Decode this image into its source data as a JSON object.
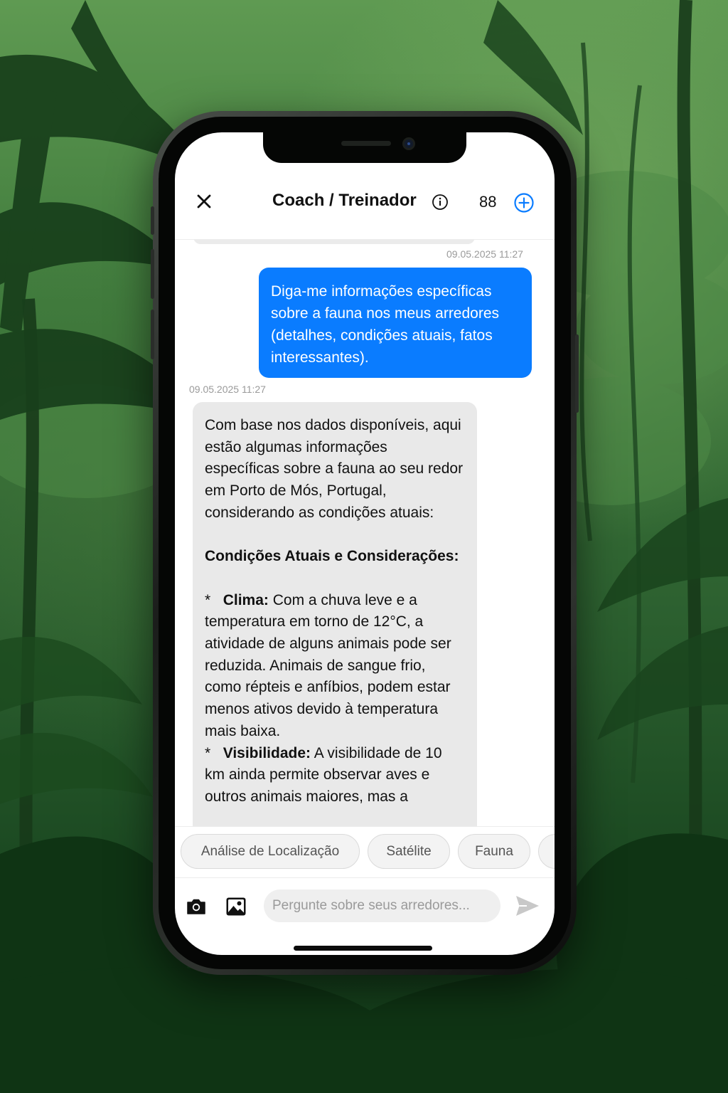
{
  "header": {
    "title": "Coach / Treinador",
    "count": "88"
  },
  "messages": [
    {
      "role": "user",
      "timestamp": "09.05.2025 11:27",
      "text": "Diga-me informações específicas sobre a fauna nos meus arredores (detalhes, condições atuais, fatos interessantes)."
    },
    {
      "role": "assistant",
      "timestamp": "09.05.2025 11:27",
      "intro": "Com base nos dados disponíveis, aqui estão algumas informações específicas sobre a fauna ao seu redor em Porto de Mós, Portugal, considerando as condições atuais:",
      "section_title": "Condições Atuais e Considerações:",
      "bullets": [
        {
          "marker": "*",
          "label": "Clima:",
          "text": "Com a chuva leve e a temperatura em torno de 12°C, a atividade de alguns animais pode ser reduzida. Animais de sangue frio, como répteis e anfíbios, podem estar menos ativos devido à temperatura mais baixa."
        },
        {
          "marker": "*",
          "label": "Visibilidade:",
          "text": "A visibilidade de 10 km ainda permite observar aves e outros animais maiores, mas a"
        }
      ]
    }
  ],
  "chips": [
    "Análise de Localização",
    "Satélite",
    "Fauna"
  ],
  "input": {
    "placeholder": "Pergunte sobre seus arredores..."
  },
  "icons": {
    "close": "close-icon",
    "info": "info-icon",
    "add": "plus-circle-icon",
    "camera": "camera-icon",
    "gallery": "image-icon",
    "send": "send-icon"
  },
  "colors": {
    "accent": "#0a7cff",
    "user_bubble": "#0a7cff",
    "bot_bubble": "#e9e9e9",
    "background_green": "#2d6130"
  }
}
